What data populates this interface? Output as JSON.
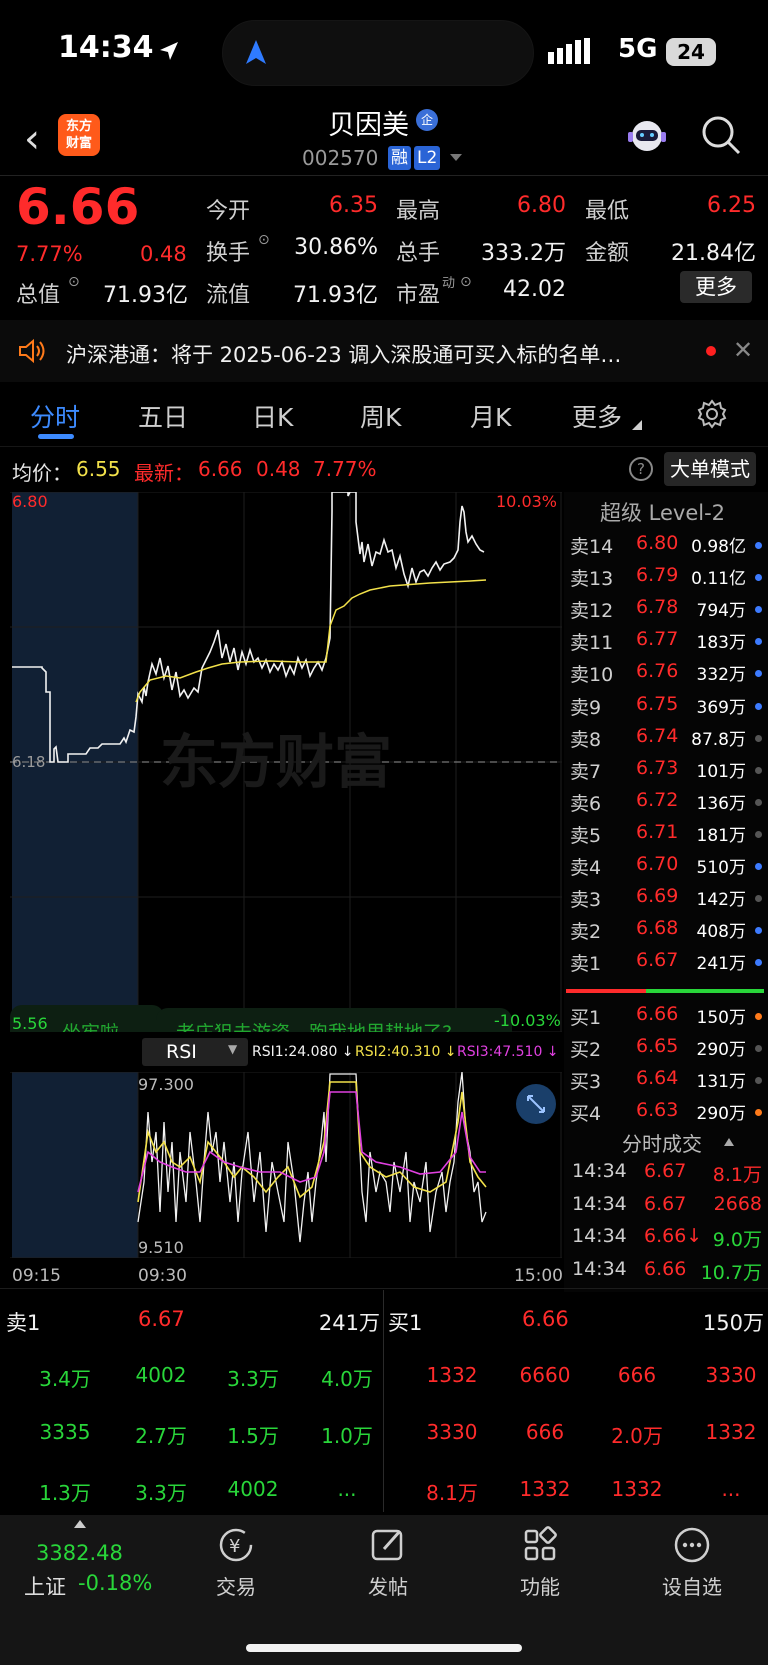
{
  "status_bar": {
    "time": "14:34",
    "network": "5G",
    "battery": "24"
  },
  "header": {
    "logo_line1": "东方",
    "logo_line2": "财富",
    "stock_name": "贝因美",
    "badge": "企",
    "stock_code": "002570",
    "tag1": "融",
    "tag2": "L2"
  },
  "quote": {
    "price": "6.66",
    "change_pct": "7.77%",
    "change": "0.48",
    "open_label": "今开",
    "open": "6.35",
    "high_label": "最高",
    "high": "6.80",
    "low_label": "最低",
    "low": "6.25",
    "turnover_label": "换手",
    "turnover": "30.86%",
    "volume_label": "总手",
    "volume": "333.2万",
    "amount_label": "金额",
    "amount": "21.84亿",
    "mktcap_label": "总值",
    "mktcap": "71.93亿",
    "float_label": "流值",
    "float_cap": "71.93亿",
    "pe_label": "市盈",
    "pe_sup": "动",
    "pe": "42.02",
    "more_btn": "更多"
  },
  "notice": {
    "text": "沪深港通：将于 2025-06-23 调入深股通可买入标的名单…"
  },
  "tabs": [
    "分时",
    "五日",
    "日K",
    "周K",
    "月K",
    "更多"
  ],
  "chart_header": {
    "avg_label": "均价：",
    "avg": "6.55",
    "last_label": "最新：",
    "last": "6.66",
    "chg": "0.48",
    "chg_pct": "7.77%",
    "mode_btn": "大单模式"
  },
  "chart_labels": {
    "top_price": "6.80",
    "top_pct": "10.03%",
    "mid_price": "6.18",
    "bottom_price": "5.56",
    "bottom_pct": "-10.03%",
    "watermark": "东方财富",
    "banner1": "坐牢啦",
    "banner2": "老庄狙击游资，跑我地里耕地了?",
    "time_start": "09:15",
    "time_open": "09:30",
    "time_end": "15:00"
  },
  "rsi": {
    "selector": "RSI",
    "rsi1": "RSI1:24.080 ↓",
    "rsi2": "RSI2:40.310 ↓",
    "rsi3": "RSI3:47.510 ↓",
    "top": "97.300",
    "bottom": "9.510"
  },
  "order_book": {
    "title": "超级 Level-2",
    "asks": [
      {
        "label": "卖14",
        "price": "6.80",
        "vol": "0.98亿",
        "dot": "#3d7bff"
      },
      {
        "label": "卖13",
        "price": "6.79",
        "vol": "0.11亿",
        "dot": "#3d7bff"
      },
      {
        "label": "卖12",
        "price": "6.78",
        "vol": "794万",
        "dot": "#3d7bff"
      },
      {
        "label": "卖11",
        "price": "6.77",
        "vol": "183万",
        "dot": "#3d7bff"
      },
      {
        "label": "卖10",
        "price": "6.76",
        "vol": "332万",
        "dot": "#3d7bff"
      },
      {
        "label": "卖9",
        "price": "6.75",
        "vol": "369万",
        "dot": "#3d7bff"
      },
      {
        "label": "卖8",
        "price": "6.74",
        "vol": "87.8万",
        "dot": "#555555"
      },
      {
        "label": "卖7",
        "price": "6.73",
        "vol": "101万",
        "dot": "#555555"
      },
      {
        "label": "卖6",
        "price": "6.72",
        "vol": "136万",
        "dot": "#555555"
      },
      {
        "label": "卖5",
        "price": "6.71",
        "vol": "181万",
        "dot": "#555555"
      },
      {
        "label": "卖4",
        "price": "6.70",
        "vol": "510万",
        "dot": "#3d7bff"
      },
      {
        "label": "卖3",
        "price": "6.69",
        "vol": "142万",
        "dot": "#555555"
      },
      {
        "label": "卖2",
        "price": "6.68",
        "vol": "408万",
        "dot": "#3d7bff"
      },
      {
        "label": "卖1",
        "price": "6.67",
        "vol": "241万",
        "dot": "#3d7bff"
      }
    ],
    "bids": [
      {
        "label": "买1",
        "price": "6.66",
        "vol": "150万",
        "dot": "#ff7a1a"
      },
      {
        "label": "买2",
        "price": "6.65",
        "vol": "290万",
        "dot": "#555555"
      },
      {
        "label": "买3",
        "price": "6.64",
        "vol": "131万",
        "dot": "#555555"
      },
      {
        "label": "买4",
        "price": "6.63",
        "vol": "290万",
        "dot": "#ff7a1a"
      }
    ]
  },
  "ticks": {
    "title": "分时成交",
    "rows": [
      {
        "time": "14:34",
        "price": "6.67",
        "vol": "8.1万",
        "vol_color": "#ff2b2b"
      },
      {
        "time": "14:34",
        "price": "6.67",
        "vol": "2668",
        "vol_color": "#ff2b2b"
      },
      {
        "time": "14:34",
        "price": "6.66↓",
        "vol": "9.0万",
        "vol_color": "#29d63a"
      },
      {
        "time": "14:34",
        "price": "6.66",
        "vol": "10.7万",
        "vol_color": "#29d63a"
      }
    ]
  },
  "queue": {
    "sell_label": "卖1",
    "sell_price": "6.67",
    "sell_total": "241万",
    "buy_label": "买1",
    "buy_price": "6.66",
    "buy_total": "150万",
    "sell_cells": [
      [
        "3.4万",
        "4002",
        "3.3万",
        "4.0万"
      ],
      [
        "3335",
        "2.7万",
        "1.5万",
        "1.0万"
      ],
      [
        "1.3万",
        "3.3万",
        "4002",
        "..."
      ]
    ],
    "buy_cells": [
      [
        "1332",
        "6660",
        "666",
        "3330"
      ],
      [
        "3330",
        "666",
        "2.0万",
        "1332"
      ],
      [
        "8.1万",
        "1332",
        "1332",
        "..."
      ]
    ]
  },
  "bottom_nav": {
    "index_value": "3382.48",
    "index_name": "上证",
    "index_change": "-0.18%",
    "trade": "交易",
    "trade_glyph": "¥",
    "post": "发帖",
    "func": "功能",
    "watch": "设自选"
  },
  "colors": {
    "up": "#ff2b2b",
    "down": "#29d63a",
    "accent": "#3d8bff",
    "avg_line": "#f2e14a",
    "rsi3": "#e040e0"
  }
}
